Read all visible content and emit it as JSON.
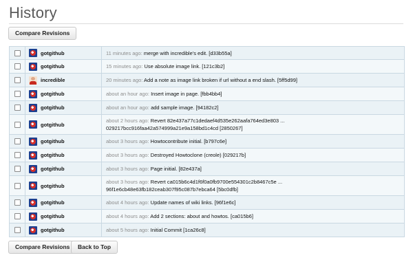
{
  "page": {
    "title": "History",
    "compare_revisions_label": "Compare Revisions",
    "back_to_top_label": "Back to Top"
  },
  "rows": [
    {
      "author": "gotgithub",
      "avatar": "gotgithub-avatar-icon",
      "time": "11 minutes ago:",
      "message": "merge with incredible's edit. [d33b55a]"
    },
    {
      "author": "gotgithub",
      "avatar": "gotgithub-avatar-icon",
      "time": "15 minutes ago:",
      "message": "Use absolute image link. [121c3b2]"
    },
    {
      "author": "incredible",
      "avatar": "incredible-avatar-icon",
      "time": "20 minutes ago:",
      "message": "Add a note as image link broken if url without a end slash. [5ff5d99]"
    },
    {
      "author": "gotgithub",
      "avatar": "gotgithub-avatar-icon",
      "time": "about an hour ago:",
      "message": "Insert image in page. [fbb4bb4]"
    },
    {
      "author": "gotgithub",
      "avatar": "gotgithub-avatar-icon",
      "time": "about an hour ago:",
      "message": "add sample image. [94182c2]"
    },
    {
      "author": "gotgithub",
      "avatar": "gotgithub-avatar-icon",
      "time": "about 2 hours ago:",
      "message": "Revert 82e437a77c1dedaef4d535e262aafa764ed3e803 ...",
      "message2": "029217bcc916faa42a574999a21e9a158bd1c4cd [2850267]"
    },
    {
      "author": "gotgithub",
      "avatar": "gotgithub-avatar-icon",
      "time": "about 3 hours ago:",
      "message": "Howtocontribute initial. [b797c6e]"
    },
    {
      "author": "gotgithub",
      "avatar": "gotgithub-avatar-icon",
      "time": "about 3 hours ago:",
      "message": "Destroyed Howtoclone (creole) [029217b]"
    },
    {
      "author": "gotgithub",
      "avatar": "gotgithub-avatar-icon",
      "time": "about 3 hours ago:",
      "message": "Page initial. [82e437a]"
    },
    {
      "author": "gotgithub",
      "avatar": "gotgithub-avatar-icon",
      "time": "about 3 hours ago:",
      "message": "Revert ca015b6c4d1f6f0a0fb9700e554301c2b8467c5e ...",
      "message2": "96f1e6cb48e63fb182ceab307f95c087b7ebca64 [5bc0dfb]"
    },
    {
      "author": "gotgithub",
      "avatar": "gotgithub-avatar-icon",
      "time": "about 4 hours ago:",
      "message": "Update names of wiki links. [96f1e6c]"
    },
    {
      "author": "gotgithub",
      "avatar": "gotgithub-avatar-icon",
      "time": "about 4 hours ago:",
      "message": "Add 2 sections: about and howtos. [ca015b6]"
    },
    {
      "author": "gotgithub",
      "avatar": "gotgithub-avatar-icon",
      "time": "about 5 hours ago:",
      "message": "Initial Commit [1ca26c8]"
    }
  ]
}
